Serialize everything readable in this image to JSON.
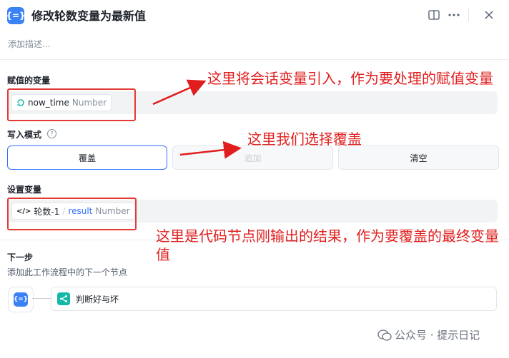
{
  "header": {
    "title": "修改轮数变量为最新值",
    "app_icon_glyph": "{=}",
    "description_placeholder": "添加描述..."
  },
  "assigned_variable": {
    "label": "赋值的变量",
    "name": "now_time",
    "type": "Number"
  },
  "write_mode": {
    "label": "写入模式",
    "options": [
      "覆盖",
      "追加",
      "清空"
    ],
    "selected": "覆盖"
  },
  "set_variable": {
    "label": "设置变量",
    "source_node": "轮数-1",
    "separator": "/",
    "name": "result",
    "type": "Number"
  },
  "next_step": {
    "title": "下一步",
    "subtitle": "添加此工作流程中的下一个节点",
    "node_label": "判断好与坏"
  },
  "annotations": {
    "a1": "这里将会话变量引入，作为要处理的赋值变量",
    "a2": "这里我们选择覆盖",
    "a3": "这里是代码节点刚输出的结果，作为要覆盖的最终变量值"
  },
  "watermark": "公众号 · 提示日记",
  "colors": {
    "accent": "#3370ff",
    "annotation_red": "#e11d1d",
    "app_icon": "#3b82f6"
  }
}
